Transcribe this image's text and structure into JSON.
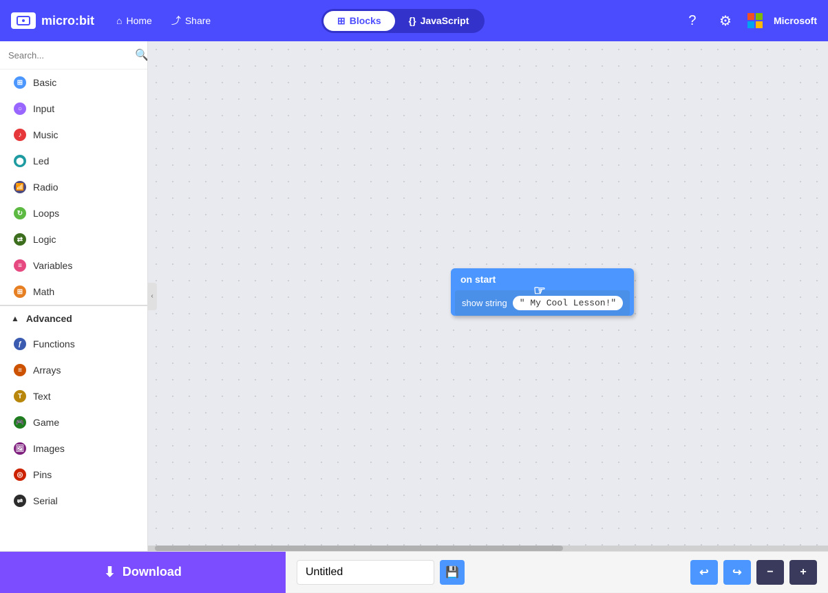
{
  "header": {
    "logo_text": "micro:bit",
    "home_label": "Home",
    "share_label": "Share",
    "blocks_label": "Blocks",
    "javascript_label": "JavaScript",
    "active_tab": "blocks"
  },
  "sidebar": {
    "search_placeholder": "Search...",
    "items": [
      {
        "id": "basic",
        "label": "Basic",
        "color": "#4c97ff"
      },
      {
        "id": "input",
        "label": "Input",
        "color": "#9966ff"
      },
      {
        "id": "music",
        "label": "Music",
        "color": "#e6373a"
      },
      {
        "id": "led",
        "label": "Led",
        "color": "#1e9aa1"
      },
      {
        "id": "radio",
        "label": "Radio",
        "color": "#4b4a80"
      },
      {
        "id": "loops",
        "label": "Loops",
        "color": "#5cb942"
      },
      {
        "id": "logic",
        "label": "Logic",
        "color": "#3d6e1e"
      },
      {
        "id": "variables",
        "label": "Variables",
        "color": "#e64980"
      },
      {
        "id": "math",
        "label": "Math",
        "color": "#e67e22"
      },
      {
        "id": "advanced",
        "label": "Advanced",
        "color": "#333",
        "is_header": true
      },
      {
        "id": "functions",
        "label": "Functions",
        "color": "#3a5bb0"
      },
      {
        "id": "arrays",
        "label": "Arrays",
        "color": "#cc5200"
      },
      {
        "id": "text",
        "label": "Text",
        "color": "#b8860b"
      },
      {
        "id": "game",
        "label": "Game",
        "color": "#1e7d1e"
      },
      {
        "id": "images",
        "label": "Images",
        "color": "#7d1e7d"
      },
      {
        "id": "pins",
        "label": "Pins",
        "color": "#cc2200"
      },
      {
        "id": "serial",
        "label": "Serial",
        "color": "#2c2c2c"
      }
    ]
  },
  "canvas": {
    "block": {
      "on_start_label": "on start",
      "show_string_label": "show string",
      "string_value": "\" My Cool Lesson!\""
    }
  },
  "bottom_bar": {
    "download_label": "Download",
    "project_name": "Untitled",
    "save_icon": "💾"
  }
}
